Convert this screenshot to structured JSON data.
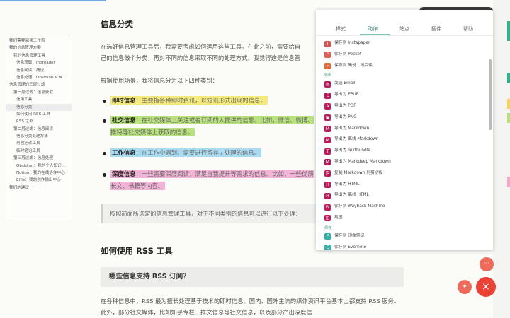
{
  "toc": [
    {
      "label": "我们需要阅读工作流",
      "level": 0
    },
    {
      "label": "我的信息管理方案",
      "level": 0
    },
    {
      "label": "我的信息管理工具",
      "level": 1
    },
    {
      "label": "信息获取：Inoreader",
      "level": 2
    },
    {
      "label": "信息阅读：简悦",
      "level": 2
    },
    {
      "label": "信息处理：Obsidian & N...",
      "level": 2
    },
    {
      "label": "信息管理的三层过滤",
      "level": 0
    },
    {
      "label": "第一层过滤：信息获取",
      "level": 1
    },
    {
      "label": "信用工具",
      "level": 2
    },
    {
      "label": "信息分类",
      "level": 2,
      "active": true
    },
    {
      "label": "如何使用 RSS 工具",
      "level": 2
    },
    {
      "label": "RSS 之外",
      "level": 2
    },
    {
      "label": "第二层过滤：信息阅读",
      "level": 1
    },
    {
      "label": "信息分类处理方法",
      "level": 2
    },
    {
      "label": "再包括读工具",
      "level": 2
    },
    {
      "label": "临时笔记工具",
      "level": 2
    },
    {
      "label": "第三层过滤：信息处理",
      "level": 1
    },
    {
      "label": "Obsidian：我的个人知识...",
      "level": 2
    },
    {
      "label": "Notion：我的在线协作中心",
      "level": 2
    },
    {
      "label": "Effie：我的创作输出中心",
      "level": 2
    },
    {
      "label": "我们的建议",
      "level": 0
    }
  ],
  "article": {
    "h_classify": "信息分类",
    "p1": "在选好信息管理工具后，我需要考虑如何运用这些工具。在此之前，需要给自己的信息做个分类，再对不同的信息采取不同的处理方式。我觉得这是信息管理的基础：信息。",
    "p2": "根据使用场景，我将信息分为以下四种类别：",
    "bullets": [
      {
        "term": "即时信息",
        "desc": "：主要指各种即时资讯，以短讯形式出现的信息。",
        "color": "#f4ea7c"
      },
      {
        "term": "社交信息",
        "desc": "：在社交媒体上关注或者订阅的人提供的信息。比如，微信、微博、推特等社交媒体上获取的信息。",
        "color": "#b7e27c"
      },
      {
        "term": "工作信息",
        "desc": "：在工作中遇到、需要进行留存 / 处理的信息。",
        "color": "#a9dcf2"
      },
      {
        "term": "深度信息",
        "desc": "：一些需要深度阅读，满足自我提升等需求的信息。比如，一些优质长文、书籍等内容。",
        "color": "#f2b3d6"
      }
    ],
    "quote": "按照前面所选定的信息管理工具，对于不同类别的信息可以进行以下处理：",
    "h_rss": "如何使用 RSS 工具",
    "q_rss": "哪些信息支持 RSS 订阅？",
    "p3": "在各种信息中，RSS 最为擅长处理基于技术的即时信息。国内、国外主流的媒体资讯平台基本上都支持 RSS 服务。此外，部分社交媒体，比如知乎专栏、推文信息等社交信息，以及部分产出深度信"
  },
  "popup": {
    "tabs": [
      "样式",
      "动作",
      "站点",
      "插件",
      "帮助"
    ],
    "active_tab": 1,
    "rows": [
      {
        "label": "保存到 Instapaper",
        "color": "#d9534f",
        "glyph": "I"
      },
      {
        "label": "保存到 Pocket",
        "color": "#e8594f",
        "glyph": "P"
      },
      {
        "label": "保存到 简悦 · 稍后读",
        "color": "#e56a38",
        "glyph": "»"
      },
      {
        "section": "导出"
      },
      {
        "label": "发送 Email",
        "color": "#c2185b",
        "glyph": "✉"
      },
      {
        "label": "导出为 EPUB",
        "color": "#c2185b",
        "glyph": "E"
      },
      {
        "label": "导出为 PDF",
        "color": "#c2185b",
        "glyph": "A"
      },
      {
        "label": "导出为 PNG",
        "color": "#c2185b",
        "glyph": "▣"
      },
      {
        "label": "导出为 Markdown",
        "color": "#c2185b",
        "glyph": "M"
      },
      {
        "label": "导出为 离线 Markdown",
        "color": "#c2185b",
        "glyph": "M"
      },
      {
        "label": "导出为 Textbundle",
        "color": "#c2185b",
        "glyph": "T"
      },
      {
        "label": "导出为 Markdeep Markdown",
        "color": "#c2185b",
        "glyph": "M"
      },
      {
        "label": "复制 Markdown 到剪切板",
        "color": "#c2185b",
        "glyph": "⎘"
      },
      {
        "label": "导出为 HTML",
        "color": "#c2185b",
        "glyph": "H"
      },
      {
        "label": "导出为 离线 HTML",
        "color": "#c2185b",
        "glyph": "H"
      },
      {
        "label": "保存到 Wayback Machine",
        "color": "#c2185b",
        "glyph": "W"
      },
      {
        "label": "截图",
        "color": "#c2185b",
        "glyph": "◫"
      },
      {
        "section": "保存"
      },
      {
        "label": "保存到 印象笔记",
        "color": "#26b5a8",
        "glyph": "E"
      },
      {
        "label": "保存到 Evernote",
        "color": "#26b5a8",
        "glyph": "E"
      }
    ]
  },
  "fabs": {
    "more": "···",
    "mid": "✦",
    "close": "×"
  },
  "edge_colors": [
    "#2fb38c",
    "#2fb38c",
    "#f6d35b",
    "#b6e07a",
    "#f2a6c9"
  ]
}
